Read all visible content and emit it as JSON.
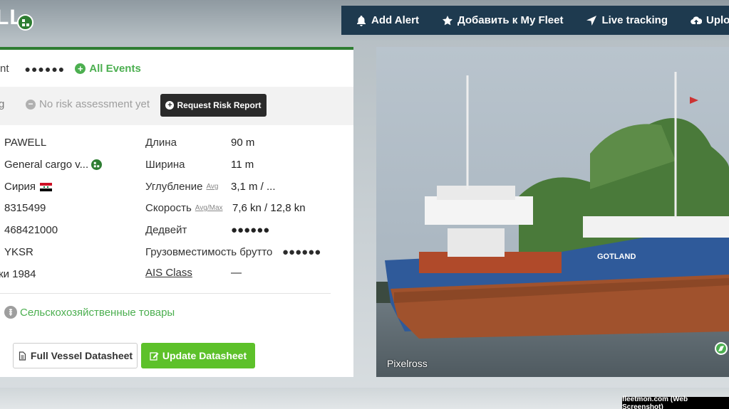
{
  "header": {
    "title": "LL"
  },
  "topnav": [
    {
      "label": "Add Alert",
      "icon": "bell-icon"
    },
    {
      "label": "Добавить к My Fleet",
      "icon": "star-icon"
    },
    {
      "label": "Live tracking",
      "icon": "location-arrow-icon"
    },
    {
      "label": "Uploa",
      "icon": "cloud-upload-icon"
    }
  ],
  "events": {
    "label": "nt",
    "value": "●●●●●●",
    "link": "All Events"
  },
  "risk": {
    "label": "g",
    "status": "No risk assessment yet",
    "button": "Request Risk Report"
  },
  "left_details": [
    "PAWELL",
    "General cargo v...",
    "Сирия",
    "8315499",
    "468421000",
    "YKSR",
    "ки 1984"
  ],
  "right_details": [
    {
      "label": "Длина",
      "value": "90 m",
      "sub": ""
    },
    {
      "label": "Ширина",
      "value": "11 m",
      "sub": ""
    },
    {
      "label": "Углубление",
      "value": "3,1 m / ...",
      "sub": "Avg"
    },
    {
      "label": "Скорость",
      "value": "7,6 kn / 12,8 kn",
      "sub": "Avg/Max"
    },
    {
      "label": "Дедвейт",
      "value": "●●●●●●",
      "sub": ""
    },
    {
      "label": "Грузовместимость брутто",
      "value": "●●●●●●",
      "sub": ""
    },
    {
      "label": "AIS Class",
      "value": "—",
      "sub": ""
    }
  ],
  "cargo": "Сельскохозяйственные товары",
  "buttons": {
    "full": "Full Vessel Datasheet",
    "update": "Update Datasheet"
  },
  "photo": {
    "credit": "Pixelross",
    "ship_name": "GOTLAND"
  },
  "watermark": "fleetmon.com (Web Screenshot)",
  "colors": {
    "nav": "#1e3a4f",
    "green": "#2e7d32",
    "accent_green": "#4caf50",
    "button_green": "#5dc12a"
  }
}
